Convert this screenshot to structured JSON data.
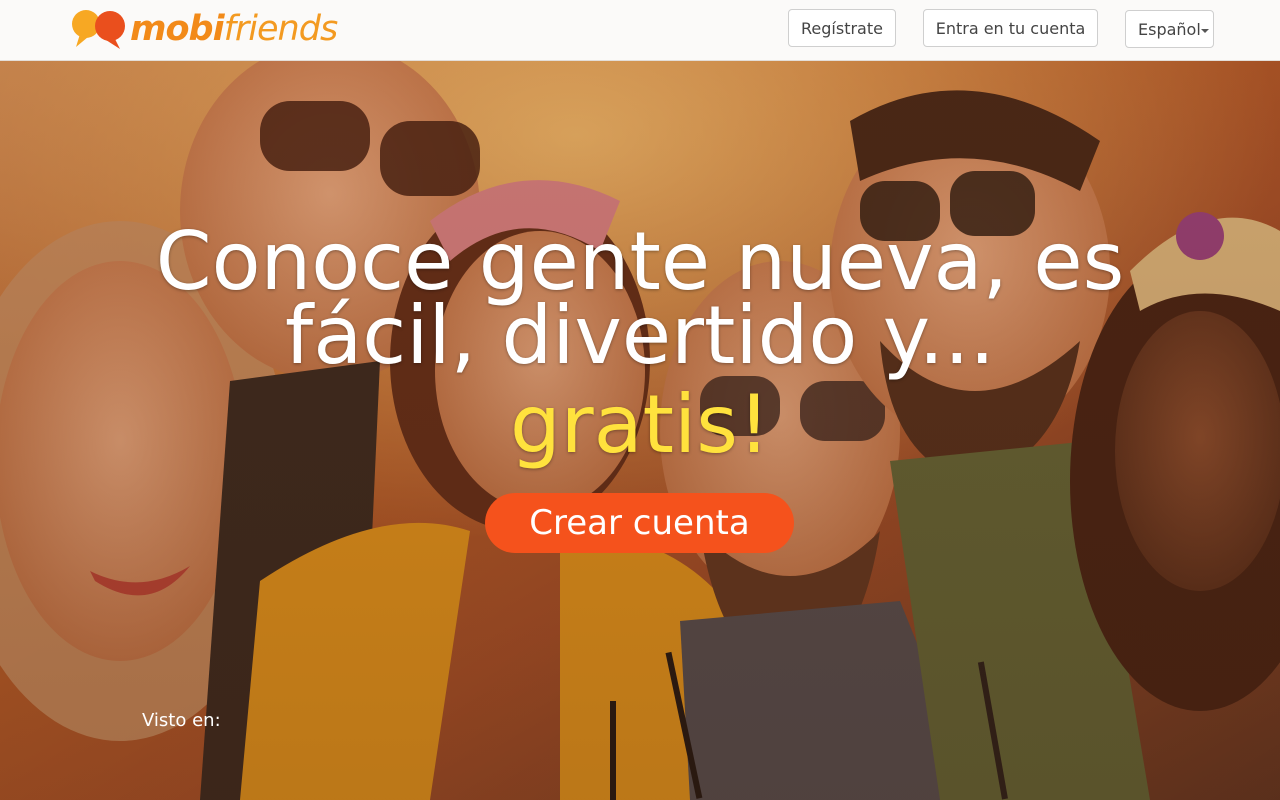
{
  "brand": {
    "name_part1": "mobi",
    "name_part2": "friends",
    "colors": {
      "orange": "#f28a19",
      "logo_red": "#ea4f1d",
      "logo_yellow": "#f7a823"
    }
  },
  "header": {
    "register_label": "Regístrate",
    "login_label": "Entra en tu cuenta",
    "language": {
      "selected": "Español"
    }
  },
  "hero": {
    "headline_line1": "Conoce gente nueva, es",
    "headline_line2": "fácil, divertido y...",
    "headline_highlight": "gratis!",
    "cta_label": "Crear cuenta",
    "seen_on_label": "Visto en:",
    "colors": {
      "cta": "#f5521c",
      "highlight": "#ffe23d"
    }
  }
}
